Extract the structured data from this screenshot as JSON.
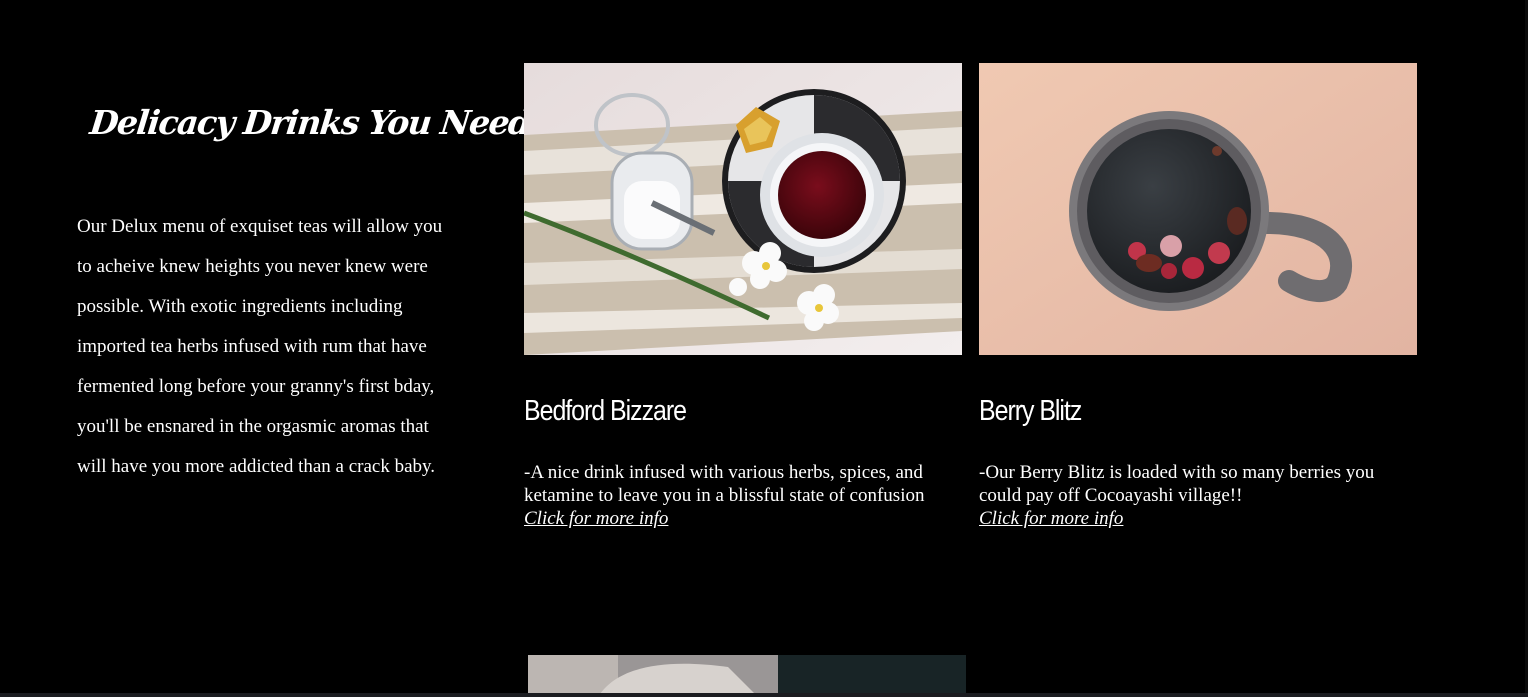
{
  "intro": {
    "title": "Delicacy Drinks You Need!",
    "description": "Our Delux menu of exquiset teas will allow you to acheive knew heights you never knew were possible. With exotic ingredients including imported tea herbs infused with rum that have fermented long before your granny's first bday, you'll be ensnared in the orgasmic aromas that will have you more addicted than a crack baby."
  },
  "products": [
    {
      "name": "Bedford Bizzare",
      "description": "-A nice drink infused with various herbs, spices, and ketamine to leave you in a blissful state of confusion",
      "link_label": "Click for more info",
      "image": "tea-cup-with-jar-and-flowers-photo"
    },
    {
      "name": "Berry Blitz",
      "description": "-Our Berry Blitz is loaded with so many berries you could pay off Cocoayashi village!!",
      "link_label": "Click for more info",
      "image": "mug-with-berries-photo"
    }
  ],
  "next_product": {
    "image": "partially-visible-drink-photo"
  },
  "colors": {
    "background": "#000000",
    "text": "#ffffff"
  }
}
